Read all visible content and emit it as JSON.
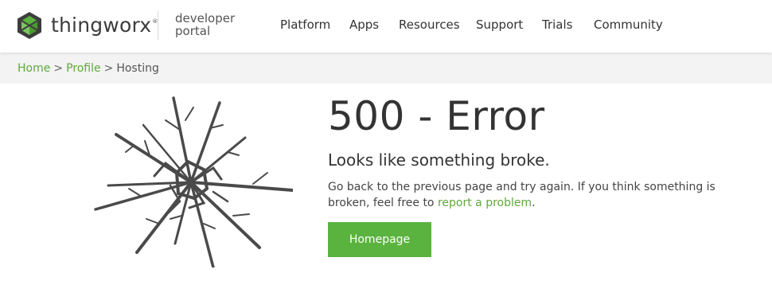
{
  "header": {
    "brand": "thingworx",
    "brand_mark": "®",
    "portal_line1": "developer",
    "portal_line2": "portal",
    "nav": [
      "Platform",
      "Apps",
      "Resources",
      "Support",
      "Trials",
      "Community"
    ]
  },
  "breadcrumb": {
    "items": [
      "Home",
      "Profile",
      "Hosting"
    ],
    "separator": ">"
  },
  "error": {
    "title": "500 - Error",
    "subtitle": "Looks like something broke.",
    "message": "Go back to the previous page and try again. If you think something is broken, feel free to ",
    "link": "report a problem",
    "message_end": ".",
    "button": "Homepage"
  },
  "colors": {
    "accent": "#5ab33e",
    "link": "#5fa83f",
    "crack": "#4a4a4a",
    "logo_dark": "#3d3d3d"
  },
  "icons": {
    "logo": "thingworx-logo-icon",
    "illustration": "broken-glass-icon"
  }
}
